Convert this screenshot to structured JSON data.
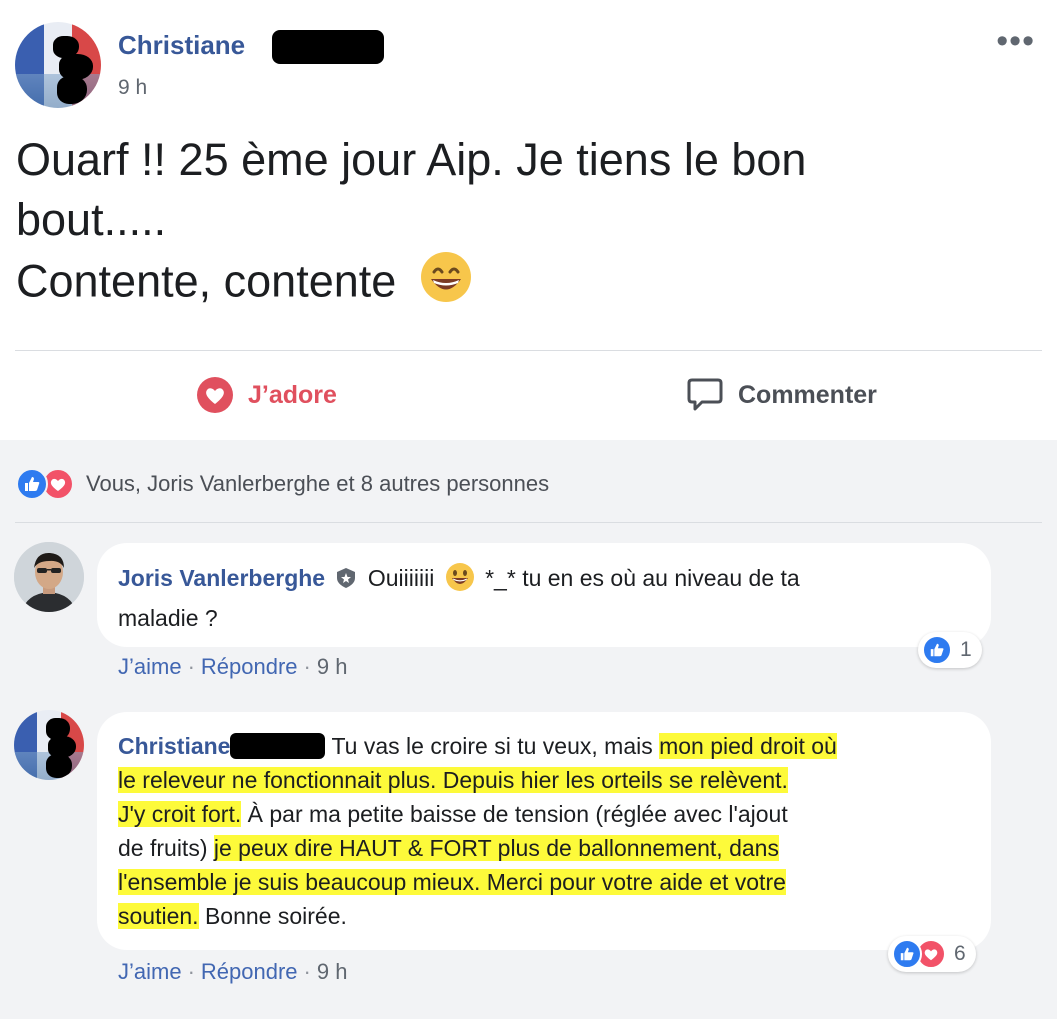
{
  "post": {
    "author": "Christiane",
    "time": "9 h",
    "more": "•••",
    "text_line1": "Ouarf !! 25 ème jour Aip. Je tiens le bon",
    "text_line2": "bout.....",
    "text_line3": "Contente, contente",
    "emoji": "grinning-face-emoji"
  },
  "actions": {
    "love_label": "J’adore",
    "comment_label": "Commenter"
  },
  "reactions_summary": {
    "text": "Vous, Joris Vanlerberghe et 8 autres personnes",
    "icons": [
      "like-icon",
      "love-icon"
    ]
  },
  "comments": [
    {
      "author": "Joris Vanlerberghe",
      "text_part1": "Ouiiiiiii",
      "text_part2": "*_* tu en es où au niveau de ta",
      "text_part3": "maladie ?",
      "like": "J’aime",
      "reply": "Répondre",
      "time": "9 h",
      "reaction_count": "1"
    },
    {
      "author": "Christiane",
      "t1": "Tu vas le croire si tu veux, mais ",
      "t1_hl": "mon pied droit où",
      "t2_hl": "le releveur ne fonctionnait plus. Depuis hier les orteils se relèvent.",
      "t3_hl": "J'y croit fort.",
      "t3": " À par ma petite baisse de tension (réglée avec l'ajout",
      "t4": "de fruits) ",
      "t4_hl": "je peux dire HAUT & FORT plus de ballonnement, dans",
      "t5_hl": "l'ensemble je suis beaucoup mieux. Merci pour votre aide et votre",
      "t6_hl": "soutien.",
      "t6": " Bonne soirée.",
      "like": "J’aime",
      "reply": "Répondre",
      "time": "9 h",
      "reaction_count": "6"
    }
  ],
  "colors": {
    "name_blue": "#385898",
    "love_red": "#e0505e",
    "like_blue": "#2e7bf0",
    "highlight": "#fdfa3a",
    "comments_bg": "#f2f3f5"
  }
}
